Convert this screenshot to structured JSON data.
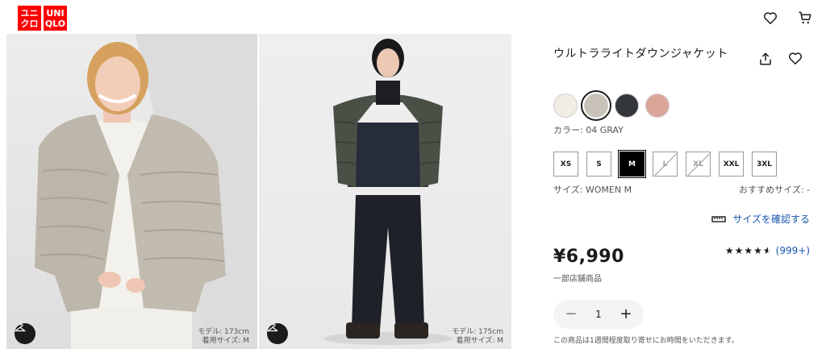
{
  "header": {
    "logo_top": "ユニ",
    "logo_bottom": "クロ",
    "logo_top_en": "UNI",
    "logo_bottom_en": "QLO",
    "wishlist_icon": "heart-icon",
    "cart_icon": "cart-icon"
  },
  "gallery": [
    {
      "model_height": "モデル: 173cm",
      "model_size": "着用サイズ: M",
      "button_icon": "hanger-icon"
    },
    {
      "model_height": "モデル: 175cm",
      "model_size": "着用サイズ: M",
      "button_icon": "hanger-icon"
    }
  ],
  "product": {
    "title": "ウルトラライトダウンジャケット",
    "share_icon": "share-icon",
    "favorite_icon": "heart-icon",
    "colors": [
      {
        "name": "off-white",
        "hex": "#f1ede4",
        "selected": false
      },
      {
        "name": "gray",
        "hex": "#c9c2b8",
        "selected": true
      },
      {
        "name": "dark-gray",
        "hex": "#33373b",
        "selected": false
      },
      {
        "name": "pink",
        "hex": "#d9a699",
        "selected": false
      }
    ],
    "color_label": "カラー: 04 GRAY",
    "sizes": [
      {
        "label": "XS",
        "state": "available"
      },
      {
        "label": "S",
        "state": "available"
      },
      {
        "label": "M",
        "state": "selected"
      },
      {
        "label": "L",
        "state": "soldout"
      },
      {
        "label": "XL",
        "state": "soldout"
      },
      {
        "label": "XXL",
        "state": "available"
      },
      {
        "label": "3XL",
        "state": "available"
      }
    ],
    "size_label": "サイズ: WOMEN M",
    "recommended_size": "おすすめサイズ: -",
    "size_check_label": "サイズを確認する",
    "size_check_icon": "ruler-icon",
    "price": "¥6,990",
    "rating_stars": "★★★★★",
    "rating_value": 4.5,
    "review_count": "(999+)",
    "stock_note": "一部店舗商品",
    "quantity": "1",
    "minus_label": "−",
    "plus_label": "+",
    "order_note": "この商品は1週間程度取り寄せにお時間をいただきます。"
  },
  "colors": {
    "brand_red": "#ff0000",
    "link_blue": "#1a56b0"
  }
}
